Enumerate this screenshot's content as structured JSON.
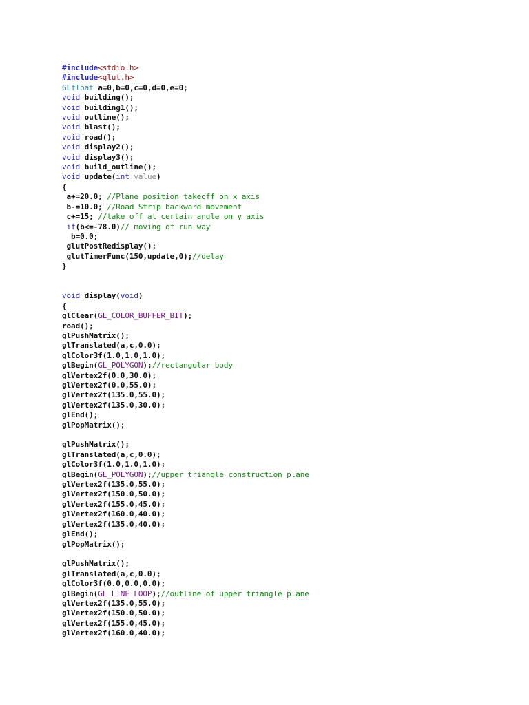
{
  "colors": {
    "keyword": "#2a2ab8",
    "string": "#a31515",
    "type": "#2b91af",
    "comment": "#118811",
    "macro": "#7a1a8a",
    "param": "#8a8a8a"
  },
  "lines": [
    [
      [
        "#include",
        "p"
      ],
      [
        "<stdio.h>",
        "s"
      ]
    ],
    [
      [
        "#include",
        "p"
      ],
      [
        "<glut.h>",
        "s"
      ]
    ],
    [
      [
        "GLfloat",
        "t"
      ],
      [
        " a=0,b=0,c=0,d=0,e=0;",
        "n"
      ]
    ],
    [
      [
        "void",
        "k"
      ],
      [
        " building();",
        "n"
      ]
    ],
    [
      [
        "void",
        "k"
      ],
      [
        " building1();",
        "n"
      ]
    ],
    [
      [
        "void",
        "k"
      ],
      [
        " outline();",
        "n"
      ]
    ],
    [
      [
        "void",
        "k"
      ],
      [
        " blast();",
        "n"
      ]
    ],
    [
      [
        "void",
        "k"
      ],
      [
        " road();",
        "n"
      ]
    ],
    [
      [
        "void",
        "k"
      ],
      [
        " display2();",
        "n"
      ]
    ],
    [
      [
        "void",
        "k"
      ],
      [
        " display3();",
        "n"
      ]
    ],
    [
      [
        "void",
        "k"
      ],
      [
        " build_outline();",
        "n"
      ]
    ],
    [
      [
        "void",
        "k"
      ],
      [
        " update(",
        "n"
      ],
      [
        "int",
        "k"
      ],
      [
        " ",
        "n"
      ],
      [
        "value",
        "g"
      ],
      [
        ")",
        "n"
      ]
    ],
    [
      [
        "{",
        "n"
      ]
    ],
    [
      [
        " a+=20.0; ",
        "n"
      ],
      [
        "//Plane position takeoff on x axis",
        "c"
      ]
    ],
    [
      [
        " b-=10.0; ",
        "n"
      ],
      [
        "//Road Strip backward movement",
        "c"
      ]
    ],
    [
      [
        " c+=15; ",
        "n"
      ],
      [
        "//take off at certain angle on y axis",
        "c"
      ]
    ],
    [
      [
        " ",
        "n"
      ],
      [
        "if",
        "k"
      ],
      [
        "(b<=-78.0)",
        "n"
      ],
      [
        "// moving of run way",
        "c"
      ]
    ],
    [
      [
        "  b=0.0;",
        "n"
      ]
    ],
    [
      [
        " glutPostRedisplay();",
        "n"
      ]
    ],
    [
      [
        " glutTimerFunc(150,update,0);",
        "n"
      ],
      [
        "//delay",
        "c"
      ]
    ],
    [
      [
        "}",
        "n"
      ]
    ],
    [],
    [],
    [
      [
        "void",
        "k"
      ],
      [
        " display(",
        "n"
      ],
      [
        "void",
        "k"
      ],
      [
        ")",
        "n"
      ]
    ],
    [
      [
        "{",
        "n"
      ]
    ],
    [
      [
        "glClear(",
        "n"
      ],
      [
        "GL_COLOR_BUFFER_BIT",
        "m"
      ],
      [
        ");",
        "n"
      ]
    ],
    [
      [
        "road();",
        "n"
      ]
    ],
    [
      [
        "glPushMatrix();",
        "n"
      ]
    ],
    [
      [
        "glTranslated(a,c,0.0);",
        "n"
      ]
    ],
    [
      [
        "glColor3f(1.0,1.0,1.0);",
        "n"
      ]
    ],
    [
      [
        "glBegin(",
        "n"
      ],
      [
        "GL_POLYGON",
        "m"
      ],
      [
        ");",
        "n"
      ],
      [
        "//rectangular body",
        "c"
      ]
    ],
    [
      [
        "glVertex2f(0.0,30.0);",
        "n"
      ]
    ],
    [
      [
        "glVertex2f(0.0,55.0);",
        "n"
      ]
    ],
    [
      [
        "glVertex2f(135.0,55.0);",
        "n"
      ]
    ],
    [
      [
        "glVertex2f(135.0,30.0);",
        "n"
      ]
    ],
    [
      [
        "glEnd();",
        "n"
      ]
    ],
    [
      [
        "glPopMatrix();",
        "n"
      ]
    ],
    [],
    [
      [
        "glPushMatrix();",
        "n"
      ]
    ],
    [
      [
        "glTranslated(a,c,0.0);",
        "n"
      ]
    ],
    [
      [
        "glColor3f(1.0,1.0,1.0);",
        "n"
      ]
    ],
    [
      [
        "glBegin(",
        "n"
      ],
      [
        "GL_POLYGON",
        "m"
      ],
      [
        ");",
        "n"
      ],
      [
        "//upper triangle construction plane",
        "c"
      ]
    ],
    [
      [
        "glVertex2f(135.0,55.0);",
        "n"
      ]
    ],
    [
      [
        "glVertex2f(150.0,50.0);",
        "n"
      ]
    ],
    [
      [
        "glVertex2f(155.0,45.0);",
        "n"
      ]
    ],
    [
      [
        "glVertex2f(160.0,40.0);",
        "n"
      ]
    ],
    [
      [
        "glVertex2f(135.0,40.0);",
        "n"
      ]
    ],
    [
      [
        "glEnd();",
        "n"
      ]
    ],
    [
      [
        "glPopMatrix();",
        "n"
      ]
    ],
    [],
    [
      [
        "glPushMatrix();",
        "n"
      ]
    ],
    [
      [
        "glTranslated(a,c,0.0);",
        "n"
      ]
    ],
    [
      [
        "glColor3f(0.0,0.0,0.0);",
        "n"
      ]
    ],
    [
      [
        "glBegin(",
        "n"
      ],
      [
        "GL_LINE_LOOP",
        "m"
      ],
      [
        ");",
        "n"
      ],
      [
        "//outline of upper triangle plane",
        "c"
      ]
    ],
    [
      [
        "glVertex2f(135.0,55.0);",
        "n"
      ]
    ],
    [
      [
        "glVertex2f(150.0,50.0);",
        "n"
      ]
    ],
    [
      [
        "glVertex2f(155.0,45.0);",
        "n"
      ]
    ],
    [
      [
        "glVertex2f(160.0,40.0);",
        "n"
      ]
    ]
  ]
}
